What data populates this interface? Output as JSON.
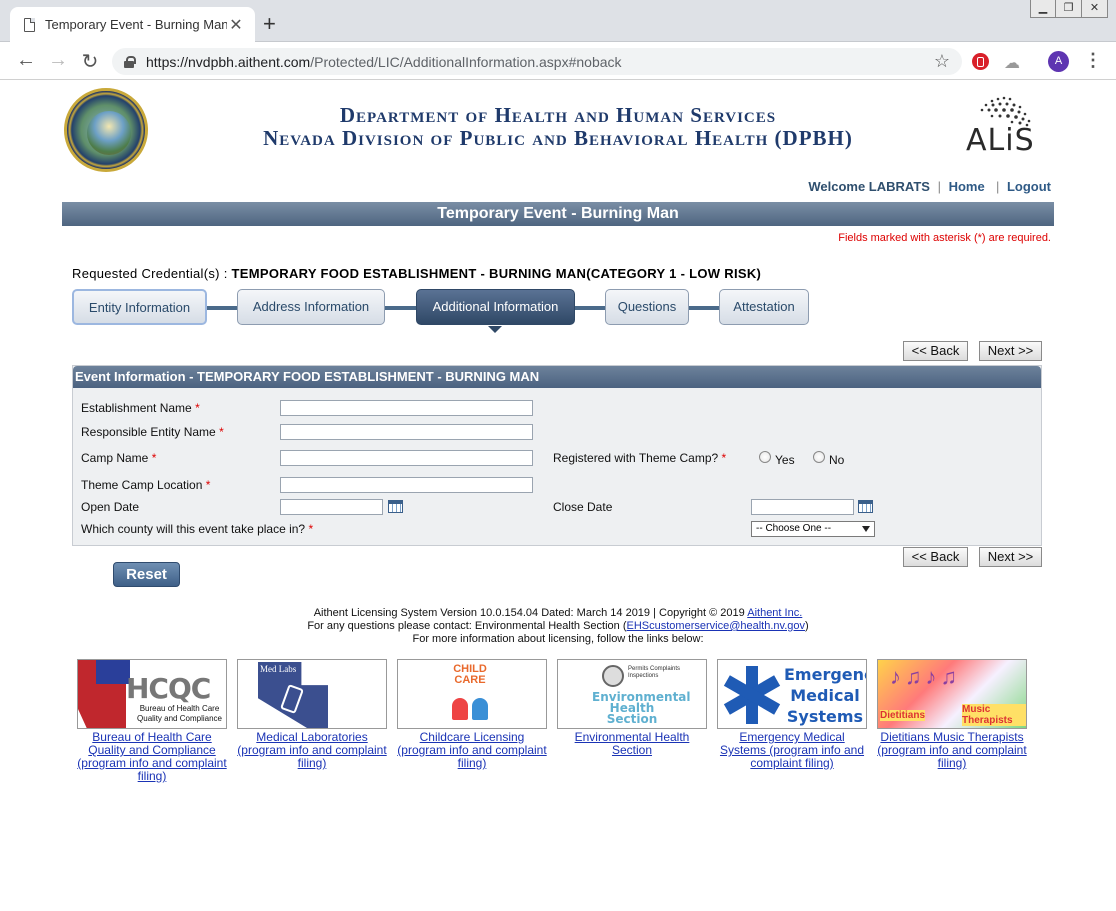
{
  "browser": {
    "tab_title": "Temporary Event - Burning Man",
    "url_host": "https://nvdpbh.aithent.com",
    "url_path": "/Protected/LIC/AdditionalInformation.aspx#noback",
    "avatar_letter": "A"
  },
  "header": {
    "dept_line1": "Department of Health and Human Services",
    "dept_line2": "Nevada Division of Public and Behavioral Health (DPBH)",
    "logo_text": "ALiS",
    "welcome": "Welcome LABRATS",
    "home": "Home",
    "logout": "Logout"
  },
  "page": {
    "title": "Temporary Event - Burning Man",
    "required_note": "Fields marked with asterisk (*) are required.",
    "credential_label": "Requested Credential(s) : ",
    "credential_value": "TEMPORARY FOOD ESTABLISHMENT - BURNING MAN(CATEGORY 1 - LOW RISK)"
  },
  "steps": [
    {
      "label": "Entity Information",
      "state": "done"
    },
    {
      "label": "Address Information",
      "state": "done"
    },
    {
      "label": "Additional Information",
      "state": "active"
    },
    {
      "label": "Questions",
      "state": "todo"
    },
    {
      "label": "Attestation",
      "state": "todo"
    }
  ],
  "nav": {
    "back": "<< Back",
    "next": "Next >>",
    "reset": "Reset"
  },
  "form": {
    "panel_title": "Event Information - TEMPORARY FOOD ESTABLISHMENT - BURNING MAN",
    "establishment_name": "Establishment Name",
    "responsible_entity": "Responsible Entity Name",
    "camp_name": "Camp Name",
    "theme_camp_location": "Theme Camp Location",
    "registered_theme_camp": "Registered with Theme Camp?",
    "yes": "Yes",
    "no": "No",
    "open_date": "Open Date",
    "close_date": "Close Date",
    "county_question": "Which county will this event take place in?",
    "county_selected": "-- Choose One --",
    "asterisk": "*"
  },
  "footer": {
    "line1_prefix": "Aithent Licensing System Version 10.0.154.04 Dated: March 14 2019 | Copyright © 2019 ",
    "line1_link": "Aithent Inc.",
    "line2_prefix": "For any questions please contact: Environmental Health Section (",
    "line2_email": "EHScustomerservice@health.nv.gov",
    "line2_suffix": ")",
    "line3": "For more information about licensing, follow the links below:"
  },
  "links": [
    {
      "caption": "Bureau of Health Care Quality and Compliance (program info and complaint filing)",
      "logo_text": "HCQC",
      "logo_sub": "Bureau of Health Care Quality and Compliance"
    },
    {
      "caption": "Medical Laboratories (program info and complaint filing)",
      "logo_text": "Med Labs"
    },
    {
      "caption": "Childcare Licensing (program info and complaint filing)",
      "logo_text": "CHILD CARE"
    },
    {
      "caption": "Environmental Health Section",
      "logo_text": "Environmental Health Section",
      "logo_sub": "Permits Complaints Inspections"
    },
    {
      "caption": "Emergency Medical Systems (program info and complaint filing)",
      "logo_text": "Emergency Medical Systems"
    },
    {
      "caption": "Dietitians Music Therapists (program info and complaint filing)",
      "logo_text": "Dietitians",
      "logo_sub": "Music Therapists"
    }
  ]
}
